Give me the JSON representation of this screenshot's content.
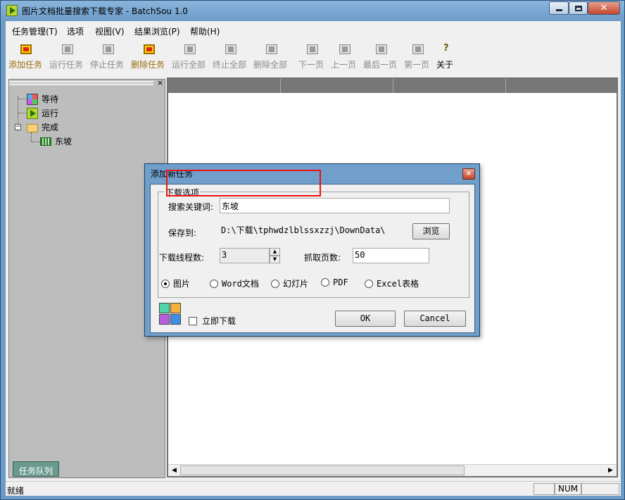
{
  "window": {
    "title": "图片文档批量搜索下载专家 - BatchSou 1.0",
    "close_glyph": "✕"
  },
  "menu": [
    {
      "label": "任务管理(T)"
    },
    {
      "label": "选项"
    },
    {
      "label": "视图(V)"
    },
    {
      "label": "结果浏览(P)"
    },
    {
      "label": "帮助(H)"
    }
  ],
  "toolbar": [
    {
      "label": "添加任务",
      "enabled": true
    },
    {
      "label": "运行任务",
      "enabled": false
    },
    {
      "label": "停止任务",
      "enabled": false
    },
    {
      "label": "删除任务",
      "enabled": true
    },
    {
      "label": "运行全部",
      "enabled": false
    },
    {
      "label": "终止全部",
      "enabled": false
    },
    {
      "label": "删除全部",
      "enabled": false
    },
    {
      "label": "下一页",
      "enabled": false
    },
    {
      "label": "上一页",
      "enabled": false
    },
    {
      "label": "最后一页",
      "enabled": false
    },
    {
      "label": "第一页",
      "enabled": false
    },
    {
      "label": "关于",
      "enabled": true,
      "icon_glyph": "?"
    }
  ],
  "left_pane": {
    "close_glyph": "×",
    "tree": {
      "waiting": "等待",
      "running": "运行",
      "done": "完成",
      "done_expander": "−",
      "result_item": "东坡"
    },
    "tab": "任务队列"
  },
  "status": {
    "text": "就绪",
    "num": "NUM"
  },
  "dialog": {
    "title": "添加新任务",
    "close_glyph": "×",
    "group_title": "下载选项",
    "keyword_label": "搜索关键词:",
    "keyword_value": "东坡",
    "save_label": "保存到:",
    "save_path": "D:\\下载\\tphwdzlblssxzzj\\DownData\\",
    "browse_label": "浏览",
    "threads_label": "下载线程数:",
    "threads_value": "3",
    "pages_label": "抓取页数:",
    "pages_value": "50",
    "types": [
      {
        "label": "图片",
        "checked": true
      },
      {
        "label": "Word文档",
        "checked": false
      },
      {
        "label": "幻灯片",
        "checked": false
      },
      {
        "label": "PDF",
        "checked": false
      },
      {
        "label": "Excel表格",
        "checked": false
      }
    ],
    "immediate_label": "立即下载",
    "immediate_checked": false,
    "ok_label": "OK",
    "cancel_label": "Cancel",
    "spin_up": "▲",
    "spin_down": "▼"
  },
  "scroll": {
    "left": "◀",
    "right": "▶"
  }
}
